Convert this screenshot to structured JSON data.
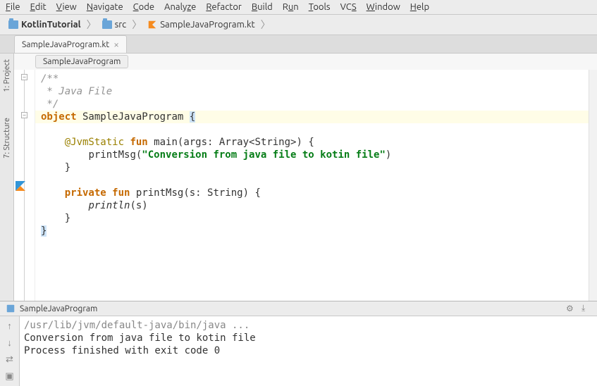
{
  "menu": [
    "File",
    "Edit",
    "View",
    "Navigate",
    "Code",
    "Analyze",
    "Refactor",
    "Build",
    "Run",
    "Tools",
    "VCS",
    "Window",
    "Help"
  ],
  "breadcrumb": {
    "project": "KotlinTutorial",
    "src": "src",
    "file": "SampleJavaProgram.kt"
  },
  "tab": {
    "label": "SampleJavaProgram.kt"
  },
  "tool_windows": {
    "project": "1: Project",
    "structure": "7: Structure"
  },
  "class_chip": "SampleJavaProgram",
  "code": {
    "c1": "/**",
    "c2": " * Java File",
    "c3": " */",
    "obj_kw": "object",
    "obj_name": " SampleJavaProgram ",
    "ann": "@JvmStatic",
    "fun_kw": "fun",
    "main_sig": " main(args: Array<String>) {",
    "print1": "printMsg(",
    "str": "\"Conversion from java file to kotin file\"",
    "print1_end": ")",
    "close1": "}",
    "priv_kw": "private",
    "printMsg_sig": " printMsg(s: String) {",
    "println_call": "println",
    "println_arg": "(s)",
    "close2": "}",
    "close3": "}"
  },
  "run": {
    "title": "SampleJavaProgram",
    "path": "/usr/lib/jvm/default-java/bin/java ...",
    "out1": "Conversion from java file to kotin file",
    "exit": "Process finished with exit code 0"
  }
}
